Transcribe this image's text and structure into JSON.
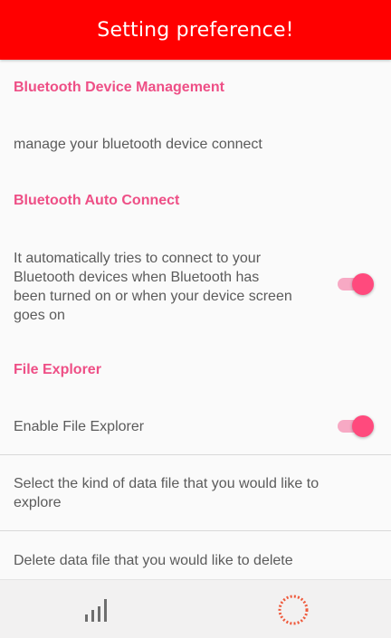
{
  "header": {
    "title": "Setting preference!"
  },
  "sections": {
    "bluetooth_device_management": {
      "title": "Bluetooth Device Management",
      "item_text": "manage your bluetooth device connect"
    },
    "bluetooth_auto_connect": {
      "title": "Bluetooth Auto Connect",
      "summary_lines": [
        "It automatically tries to connect to your",
        "Bluetooth devices when Bluetooth has",
        "been turned on or when your device screen",
        "goes on"
      ],
      "switch_on": true
    },
    "file_explorer": {
      "title": "File Explorer",
      "enable_label": "Enable File Explorer",
      "enable_switch_on": true,
      "select_lines": [
        "Select the kind of data file that you would like to",
        "explore"
      ],
      "delete_text": "Delete data file that you would like to delete"
    }
  },
  "bottom_nav": {
    "left_icon": "bar-chart-icon",
    "right_icon": "dotted-circle-icon"
  },
  "colors": {
    "header_bg": "#ff0000",
    "header_text": "#ffffff",
    "category_text": "#ee4f86",
    "body_text": "#5b5b5b",
    "switch_thumb": "#ff4a7d",
    "switch_track": "#f7a9c4",
    "nav_bg": "#f2f1f1",
    "nav_icon_gray": "#6e6e6e",
    "nav_icon_accent": "#ef5a3c"
  }
}
